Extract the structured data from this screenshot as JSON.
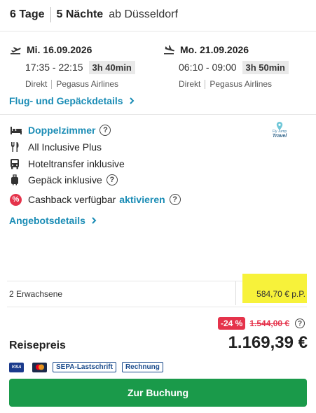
{
  "header": {
    "days": "6 Tage",
    "nights": "5 Nächte",
    "departure": "ab Düsseldorf"
  },
  "outbound": {
    "date": "Mi. 16.09.2026",
    "times": "17:35 - 22:15",
    "duration": "3h 40min",
    "type": "Direkt",
    "airline": "Pegasus Airlines"
  },
  "inbound": {
    "date": "Mo. 21.09.2026",
    "times": "06:10 - 09:00",
    "duration": "3h 50min",
    "type": "Direkt",
    "airline": "Pegasus Airlines"
  },
  "flight_link": "Flug- und Gepäckdetails",
  "features": {
    "room": "Doppelzimmer",
    "board": "All Inclusive Plus",
    "transfer": "Hoteltransfer inklusive",
    "luggage": "Gepäck inklusive",
    "cashback": "Cashback verfügbar",
    "cashback_link": "aktivieren"
  },
  "provider_logo": {
    "line1": "Fly Jump",
    "line2": "Travel"
  },
  "offer_link": "Angebotsdetails",
  "pax": {
    "label": "2 Erwachsene",
    "price_pp": "584,70 € p.P."
  },
  "price": {
    "discount": "-24 %",
    "old": "1.544,00 €",
    "label": "Reisepreis",
    "total": "1.169,39 €"
  },
  "payments": {
    "visa": "VISA",
    "sepa": "SEPA-Lastschrift",
    "invoice": "Rechnung"
  },
  "book_button": "Zur Buchung",
  "colors": {
    "accent_link": "#1a8cb5",
    "book_green": "#1a9a4a",
    "discount_red": "#e5334b",
    "highlight": "#f7f23a"
  }
}
